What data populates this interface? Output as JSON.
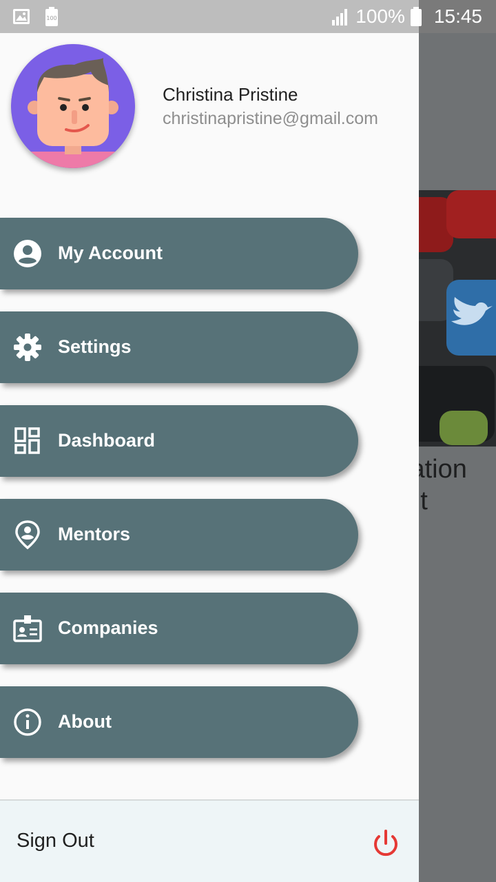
{
  "status_bar": {
    "signal_icon": "signal-icon",
    "battery_percent": "100%",
    "battery_icon": "battery-icon",
    "time": "15:45",
    "notification_icons": [
      "image-icon",
      "battery-100-icon"
    ],
    "battery_badge": "100"
  },
  "profile": {
    "name": "Christina Pristine",
    "email": "christinapristine@gmail.com",
    "avatar_icon": "cartoon-avatar"
  },
  "menu": {
    "items": [
      {
        "label": "My Account",
        "icon": "account-circle-icon"
      },
      {
        "label": "Settings",
        "icon": "gear-icon"
      },
      {
        "label": "Dashboard",
        "icon": "dashboard-icon"
      },
      {
        "label": "Mentors",
        "icon": "location-person-icon"
      },
      {
        "label": "Companies",
        "icon": "id-badge-icon"
      },
      {
        "label": "About",
        "icon": "info-icon"
      }
    ]
  },
  "footer": {
    "sign_out_label": "Sign Out",
    "sign_out_icon": "power-icon",
    "sign_out_icon_color": "#e53935"
  },
  "background_content": {
    "title_line1": "ication",
    "title_line2": "ent"
  },
  "colors": {
    "menu_button": "#577278",
    "drawer_bg": "#fafafa",
    "footer_bg": "#eef5f7",
    "scrim": "#6e7173"
  }
}
